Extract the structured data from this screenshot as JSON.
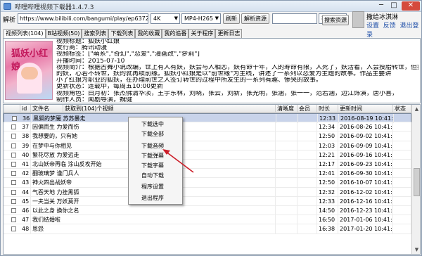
{
  "window": {
    "title": "哔哩哔哩视频下载器1.4.7.3",
    "min": "─",
    "max": "□",
    "close": "✕"
  },
  "toolbar": {
    "url_label": "解析",
    "url_value": "https://www.bilibili.com/bangumi/play/ep63725",
    "quality": "4K",
    "format": "MP4-H265",
    "refresh_button": "刷新",
    "parse_button": "解析资源",
    "search_value": "",
    "search_type": "视频",
    "search_button": "搜索资源"
  },
  "user": {
    "name": "撒给冰淇淋",
    "links": [
      "设置",
      "反馈",
      "退出登录"
    ]
  },
  "tabs": [
    "视频列表(104)",
    "B站视频(50)",
    "搜索列表",
    "下载列表",
    "我的收藏",
    "我的追番",
    "关于程序",
    "更新日志"
  ],
  "cover_text": "狐妖小红娘",
  "info_lines": [
    "视频标题：狐妖小红娘",
    "发行商：腾讯动漫",
    "视频标签：[\"萌系\",\"奇幻\",\"恋爱\",\"漫画改\",\"萝莉\"]",
    "开播时间：2015-07-10",
    "视频简介：根据古舞小说改编，世上有人有妖，妖会与人相恋，妖有命千年，人的寿命有限，人死了，妖活着，人会投胎转世，但投胎以后不记得",
    "的妖，心若不转世，妖的就再续前缘。狐妖小红娘是以\"前世缘\"为主线，讲述了一系列以恋爱为主题的故事。作品主要讲",
    "小了红娘为职业的狐妖，在办理前世之人签订转世的过程中所发生的一系列有趣、惨哭的故事。",
    "更新状态：连载中，每周五10:00更新",
    "视频角色：白月初：张杰佛清华淡，王宇东林，刘晓，张云，刘新，张光明，张涵，张一一，范若涵，边江饰演，唐小喜，",
    "制作人员：闻剧导演，魏健"
  ],
  "table": {
    "headers": [
      "id",
      "文件名",
      "获取到(104)个视频",
      "清晰度",
      "会员",
      "时长",
      "更新时间",
      "状态"
    ],
    "rows": [
      {
        "id": "36",
        "name": "黑狐的梦魇 苏苏暴走",
        "dur": "12:33",
        "date": "2016-08-19 10:41:54",
        "selected": true
      },
      {
        "id": "37",
        "name": "因偏而生 为爱而伤",
        "dur": "12:34",
        "date": "2016-08-26 10:41:54",
        "selected": false
      },
      {
        "id": "38",
        "name": "我想要的，只有她",
        "dur": "12:50",
        "date": "2016-09-02 10:41:54",
        "selected": false
      },
      {
        "id": "39",
        "name": "在梦中与你相见",
        "dur": "12:03",
        "date": "2016-09-09 10:41:54",
        "selected": false
      },
      {
        "id": "40",
        "name": "繁花尽放 为爱远走",
        "dur": "12:21",
        "date": "2016-09-16 10:41:54",
        "selected": false
      },
      {
        "id": "41",
        "name": "北山妖帝再临 涂山反攻开始",
        "dur": "12:17",
        "date": "2016-09-23 10:41:54",
        "selected": false
      },
      {
        "id": "42",
        "name": "翻玻璃梦 谨门兵人",
        "dur": "12:41",
        "date": "2016-09-30 10:41:54",
        "selected": false
      },
      {
        "id": "43",
        "name": "神火四出战妖帝",
        "dur": "12:50",
        "date": "2016-10-07 10:41:54",
        "selected": false
      },
      {
        "id": "44",
        "name": "气吞天地 力挫黑狐",
        "dur": "12:32",
        "date": "2016-12-02 10:41:54",
        "selected": false
      },
      {
        "id": "45",
        "name": "一夫当关 万妖莫开",
        "dur": "12:33",
        "date": "2016-12-16 10:41:54",
        "selected": false
      },
      {
        "id": "46",
        "name": "以此之身 换你之名",
        "dur": "14:50",
        "date": "2016-12-23 10:41:54",
        "selected": false
      },
      {
        "id": "47",
        "name": "我们结婚啦",
        "dur": "16:50",
        "date": "2017-01-06 10:41:54",
        "selected": false
      },
      {
        "id": "48",
        "name": "恩怨",
        "dur": "16:38",
        "date": "2017-01-20 10:41:54",
        "selected": false
      }
    ]
  },
  "context_menu": [
    "下载选中",
    "下载全部",
    "下载音频",
    "下载弹幕",
    "下载字幕",
    "自动下载",
    "程序设置",
    "退出程序"
  ],
  "colors": {
    "selection": "#c8d3ea",
    "link": "#1f4fa8",
    "arrow": "#cc1f2a"
  }
}
